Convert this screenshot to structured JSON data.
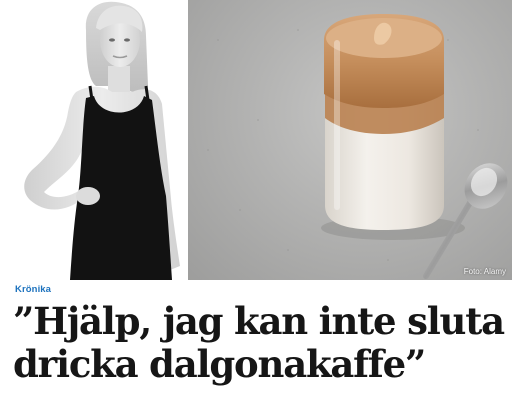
{
  "article": {
    "section_label": "Krönika",
    "headline": "”Hjälp, jag kan inte sluta dricka dalgonakaffe”",
    "photo_credit": "Foto: Alamy"
  },
  "colors": {
    "section_label": "#1e73be",
    "headline": "#161616",
    "background": "#ffffff"
  }
}
